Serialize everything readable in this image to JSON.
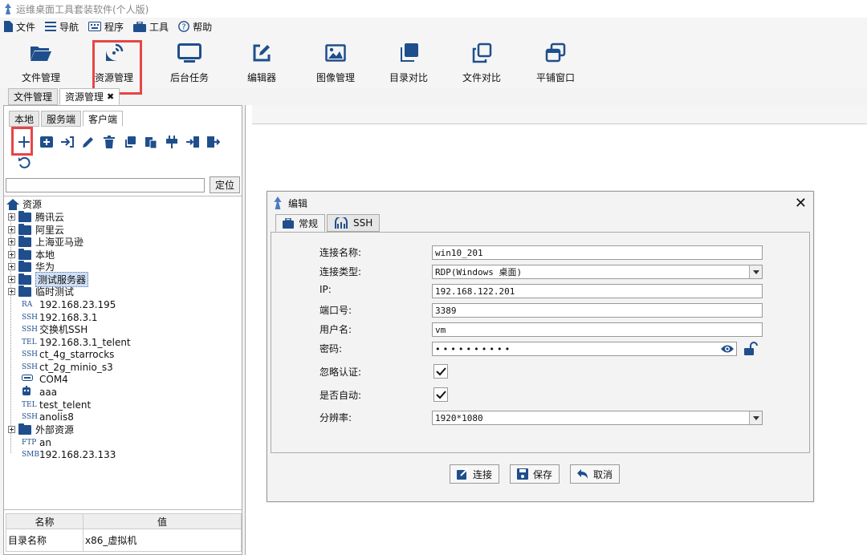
{
  "window": {
    "title": "运维桌面工具套装软件(个人版)"
  },
  "menubar": {
    "file": "文件",
    "nav": "导航",
    "program": "程序",
    "tools": "工具",
    "help": "帮助"
  },
  "toolbar": {
    "file_manage": "文件管理",
    "resource_manage": "资源管理",
    "background_task": "后台任务",
    "editor": "编辑器",
    "image_manage": "图像管理",
    "dir_compare": "目录对比",
    "file_compare": "文件对比",
    "tile_window": "平铺窗口"
  },
  "outer_tabs": {
    "file_manage": "文件管理",
    "resource_manage": "资源管理",
    "close": "✖"
  },
  "inner_tabs": {
    "local": "本地",
    "server": "服务端",
    "client": "客户端"
  },
  "search": {
    "value": "",
    "locate_button": "定位"
  },
  "tree": {
    "root": "资源",
    "folders": [
      "腾讯云",
      "阿里云",
      "上海亚马逊",
      "本地",
      "华为",
      "测试服务器",
      "临时测试"
    ],
    "items": [
      {
        "tag": "RA",
        "label": "192.168.23.195"
      },
      {
        "tag": "SSH",
        "label": "192.168.3.1"
      },
      {
        "tag": "SSH",
        "label": "交换机SSH"
      },
      {
        "tag": "TEL",
        "label": "192.168.3.1_telent"
      },
      {
        "tag": "SSH",
        "label": "ct_4g_starrocks"
      },
      {
        "tag": "SSH",
        "label": "ct_2g_minio_s3"
      },
      {
        "tag": "",
        "label": "COM4"
      },
      {
        "tag": "",
        "label": "aaa"
      },
      {
        "tag": "TEL",
        "label": "test_telent"
      },
      {
        "tag": "SSH",
        "label": "anolis8"
      }
    ],
    "folder_external": "外部资源",
    "items2": [
      {
        "tag": "FTP",
        "label": "an"
      },
      {
        "tag": "SMB",
        "label": "192.168.23.133"
      }
    ]
  },
  "props": {
    "col_name": "名称",
    "col_value": "值",
    "rows": [
      {
        "name": "目录名称",
        "value": "x86_虚拟机"
      }
    ]
  },
  "dialog": {
    "title": "编辑",
    "close": "✕",
    "tabs": {
      "general": "常规",
      "ssh": "SSH"
    },
    "labels": {
      "conn_name": "连接名称:",
      "conn_type": "连接类型:",
      "ip": "IP:",
      "port": "端口号:",
      "user": "用户名:",
      "password": "密码:",
      "ignore_auth": "忽略认证:",
      "auto": "是否自动:",
      "resolution": "分辨率:"
    },
    "values": {
      "conn_name": "win10_201",
      "conn_type": "RDP(Windows 桌面)",
      "ip": "192.168.122.201",
      "port": "3389",
      "user": "vm",
      "password": "••••••••••",
      "resolution": "1920*1080"
    },
    "buttons": {
      "connect": "连接",
      "save": "保存",
      "cancel": "取消"
    }
  },
  "colors": {
    "icon_blue": "#1f4e8c",
    "highlight_red": "#e84545"
  }
}
